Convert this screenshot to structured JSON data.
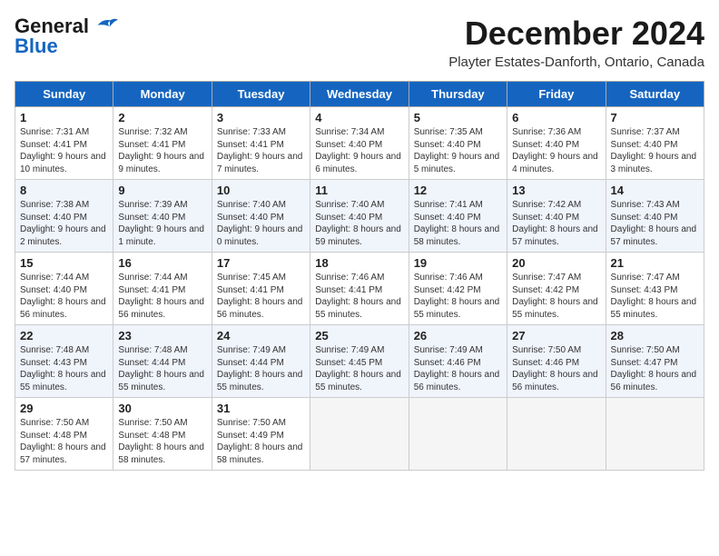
{
  "logo": {
    "general": "General",
    "blue": "Blue"
  },
  "title": "December 2024",
  "subtitle": "Playter Estates-Danforth, Ontario, Canada",
  "days": [
    "Sunday",
    "Monday",
    "Tuesday",
    "Wednesday",
    "Thursday",
    "Friday",
    "Saturday"
  ],
  "weeks": [
    [
      {
        "day": "1",
        "sunrise": "7:31 AM",
        "sunset": "4:41 PM",
        "daylight": "9 hours and 10 minutes."
      },
      {
        "day": "2",
        "sunrise": "7:32 AM",
        "sunset": "4:41 PM",
        "daylight": "9 hours and 9 minutes."
      },
      {
        "day": "3",
        "sunrise": "7:33 AM",
        "sunset": "4:41 PM",
        "daylight": "9 hours and 7 minutes."
      },
      {
        "day": "4",
        "sunrise": "7:34 AM",
        "sunset": "4:40 PM",
        "daylight": "9 hours and 6 minutes."
      },
      {
        "day": "5",
        "sunrise": "7:35 AM",
        "sunset": "4:40 PM",
        "daylight": "9 hours and 5 minutes."
      },
      {
        "day": "6",
        "sunrise": "7:36 AM",
        "sunset": "4:40 PM",
        "daylight": "9 hours and 4 minutes."
      },
      {
        "day": "7",
        "sunrise": "7:37 AM",
        "sunset": "4:40 PM",
        "daylight": "9 hours and 3 minutes."
      }
    ],
    [
      {
        "day": "8",
        "sunrise": "7:38 AM",
        "sunset": "4:40 PM",
        "daylight": "9 hours and 2 minutes."
      },
      {
        "day": "9",
        "sunrise": "7:39 AM",
        "sunset": "4:40 PM",
        "daylight": "9 hours and 1 minute."
      },
      {
        "day": "10",
        "sunrise": "7:40 AM",
        "sunset": "4:40 PM",
        "daylight": "9 hours and 0 minutes."
      },
      {
        "day": "11",
        "sunrise": "7:40 AM",
        "sunset": "4:40 PM",
        "daylight": "8 hours and 59 minutes."
      },
      {
        "day": "12",
        "sunrise": "7:41 AM",
        "sunset": "4:40 PM",
        "daylight": "8 hours and 58 minutes."
      },
      {
        "day": "13",
        "sunrise": "7:42 AM",
        "sunset": "4:40 PM",
        "daylight": "8 hours and 57 minutes."
      },
      {
        "day": "14",
        "sunrise": "7:43 AM",
        "sunset": "4:40 PM",
        "daylight": "8 hours and 57 minutes."
      }
    ],
    [
      {
        "day": "15",
        "sunrise": "7:44 AM",
        "sunset": "4:40 PM",
        "daylight": "8 hours and 56 minutes."
      },
      {
        "day": "16",
        "sunrise": "7:44 AM",
        "sunset": "4:41 PM",
        "daylight": "8 hours and 56 minutes."
      },
      {
        "day": "17",
        "sunrise": "7:45 AM",
        "sunset": "4:41 PM",
        "daylight": "8 hours and 56 minutes."
      },
      {
        "day": "18",
        "sunrise": "7:46 AM",
        "sunset": "4:41 PM",
        "daylight": "8 hours and 55 minutes."
      },
      {
        "day": "19",
        "sunrise": "7:46 AM",
        "sunset": "4:42 PM",
        "daylight": "8 hours and 55 minutes."
      },
      {
        "day": "20",
        "sunrise": "7:47 AM",
        "sunset": "4:42 PM",
        "daylight": "8 hours and 55 minutes."
      },
      {
        "day": "21",
        "sunrise": "7:47 AM",
        "sunset": "4:43 PM",
        "daylight": "8 hours and 55 minutes."
      }
    ],
    [
      {
        "day": "22",
        "sunrise": "7:48 AM",
        "sunset": "4:43 PM",
        "daylight": "8 hours and 55 minutes."
      },
      {
        "day": "23",
        "sunrise": "7:48 AM",
        "sunset": "4:44 PM",
        "daylight": "8 hours and 55 minutes."
      },
      {
        "day": "24",
        "sunrise": "7:49 AM",
        "sunset": "4:44 PM",
        "daylight": "8 hours and 55 minutes."
      },
      {
        "day": "25",
        "sunrise": "7:49 AM",
        "sunset": "4:45 PM",
        "daylight": "8 hours and 55 minutes."
      },
      {
        "day": "26",
        "sunrise": "7:49 AM",
        "sunset": "4:46 PM",
        "daylight": "8 hours and 56 minutes."
      },
      {
        "day": "27",
        "sunrise": "7:50 AM",
        "sunset": "4:46 PM",
        "daylight": "8 hours and 56 minutes."
      },
      {
        "day": "28",
        "sunrise": "7:50 AM",
        "sunset": "4:47 PM",
        "daylight": "8 hours and 56 minutes."
      }
    ],
    [
      {
        "day": "29",
        "sunrise": "7:50 AM",
        "sunset": "4:48 PM",
        "daylight": "8 hours and 57 minutes."
      },
      {
        "day": "30",
        "sunrise": "7:50 AM",
        "sunset": "4:48 PM",
        "daylight": "8 hours and 58 minutes."
      },
      {
        "day": "31",
        "sunrise": "7:50 AM",
        "sunset": "4:49 PM",
        "daylight": "8 hours and 58 minutes."
      },
      null,
      null,
      null,
      null
    ]
  ]
}
